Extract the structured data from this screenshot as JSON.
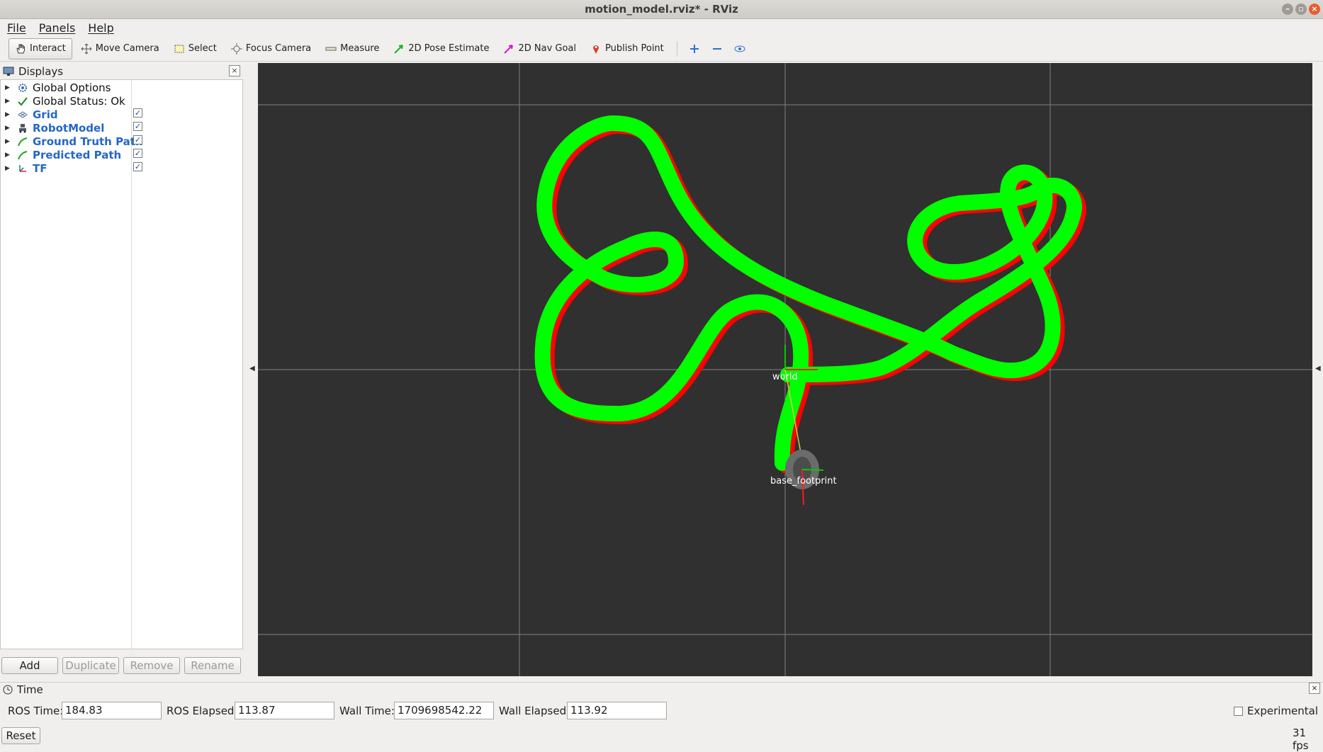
{
  "window": {
    "title": "motion_model.rviz* - RViz"
  },
  "menu": {
    "items": [
      "File",
      "Panels",
      "Help"
    ]
  },
  "toolbar": {
    "tools": [
      {
        "label": "Interact",
        "icon": "hand-icon",
        "active": true
      },
      {
        "label": "Move Camera",
        "icon": "move-camera-icon"
      },
      {
        "label": "Select",
        "icon": "select-icon"
      },
      {
        "label": "Focus Camera",
        "icon": "focus-camera-icon"
      },
      {
        "label": "Measure",
        "icon": "ruler-icon"
      },
      {
        "label": "2D Pose Estimate",
        "icon": "pose-estimate-arrow-icon"
      },
      {
        "label": "2D Nav Goal",
        "icon": "nav-goal-arrow-icon"
      },
      {
        "label": "Publish Point",
        "icon": "map-pin-icon"
      }
    ]
  },
  "displays": {
    "title": "Displays",
    "items": [
      {
        "label": "Global Options",
        "icon": "gear-icon",
        "checkbox": false,
        "blue": false
      },
      {
        "label": "Global Status: Ok",
        "icon": "checkmark-icon",
        "checkbox": false,
        "blue": false
      },
      {
        "label": "Grid",
        "icon": "grid-icon",
        "checkbox": true,
        "checked": true,
        "blue": true
      },
      {
        "label": "RobotModel",
        "icon": "robot-icon",
        "checkbox": true,
        "checked": true,
        "blue": true
      },
      {
        "label": "Ground Truth Path",
        "icon": "path-icon",
        "checkbox": true,
        "checked": true,
        "blue": true
      },
      {
        "label": "Predicted Path",
        "icon": "path-icon",
        "checkbox": true,
        "checked": true,
        "blue": true
      },
      {
        "label": "TF",
        "icon": "tf-axes-icon",
        "checkbox": true,
        "checked": true,
        "blue": true
      }
    ],
    "buttons": {
      "add": "Add",
      "duplicate": "Duplicate",
      "remove": "Remove",
      "rename": "Rename"
    }
  },
  "view": {
    "frames": {
      "world": "world",
      "base": "base_footprint"
    },
    "colors": {
      "background": "#303030",
      "ground_truth": "#ff0000",
      "predicted": "#00ff00",
      "grid": "#a0a0a0"
    }
  },
  "time": {
    "title": "Time",
    "ros_time_label": "ROS Time:",
    "ros_time": "184.83",
    "ros_elapsed_label": "ROS Elapsed:",
    "ros_elapsed": "113.87",
    "wall_time_label": "Wall Time:",
    "wall_time": "1709698542.22",
    "wall_elapsed_label": "Wall Elapsed:",
    "wall_elapsed": "113.92",
    "experimental_label": "Experimental",
    "reset_label": "Reset",
    "fps": "31 fps"
  }
}
